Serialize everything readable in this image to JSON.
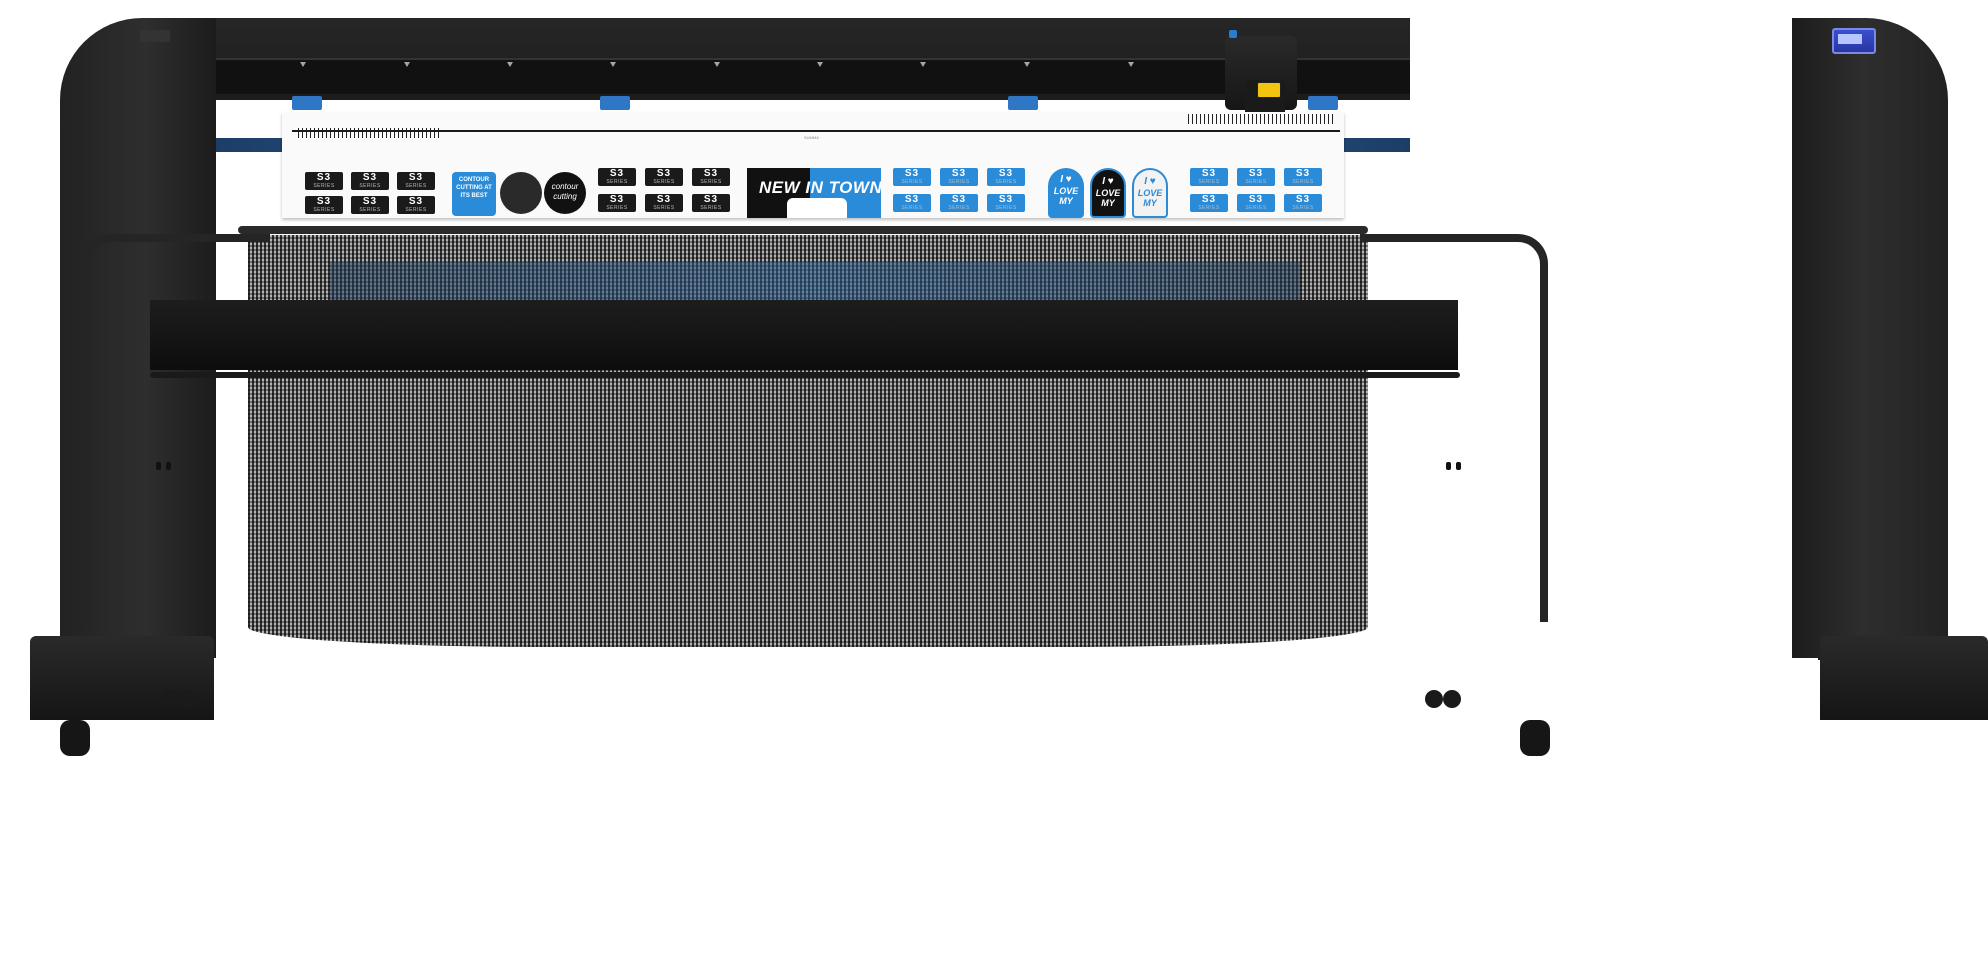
{
  "scene": {
    "subject": "S3 Series cutting plotter with media basket"
  },
  "media": {
    "small_label": "SUMMA",
    "tiles": [
      {
        "big": "S3",
        "small": "SERIES"
      }
    ],
    "contour_sticker": "CONTOUR CUTTING AT ITS BEST",
    "round_sticker": "contour cutting",
    "banner": "NEW IN TOWN",
    "love_sticker_top": "I ♥",
    "love_sticker_bottom": "LOVE MY"
  },
  "colors": {
    "frame": "#222222",
    "accent_blue": "#2a8bd8",
    "media": "#fafafa",
    "warning": "#f1c40f"
  }
}
